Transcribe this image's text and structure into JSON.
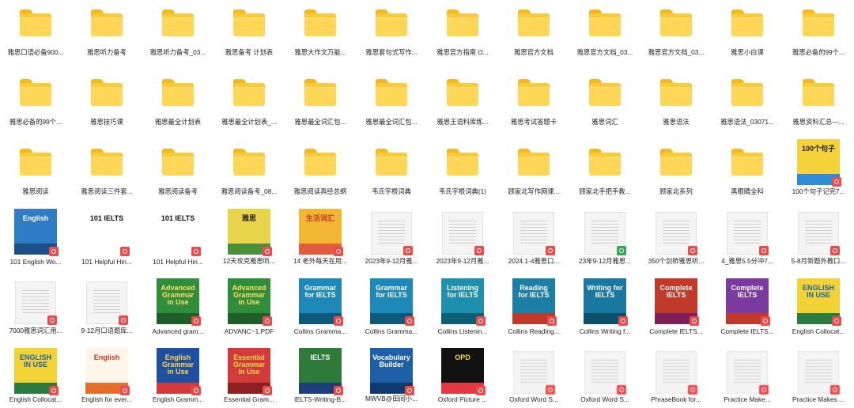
{
  "colors": {
    "folder": "#fcca36",
    "pdf_badge": "#ec4b4b",
    "xls_badge": "#32a852"
  },
  "items": [
    {
      "label": "雅思口语必备900...",
      "type": "folder"
    },
    {
      "label": "雅思听力备考",
      "type": "folder"
    },
    {
      "label": "雅思听力备考_03...",
      "type": "folder"
    },
    {
      "label": "雅思备考 计划表",
      "type": "folder"
    },
    {
      "label": "雅思大作文万能...",
      "type": "folder"
    },
    {
      "label": "雅思套句式写作...",
      "type": "folder"
    },
    {
      "label": "雅思官方指南 O...",
      "type": "folder"
    },
    {
      "label": "雅思官方文档",
      "type": "folder"
    },
    {
      "label": "雅思官方文档_03...",
      "type": "folder"
    },
    {
      "label": "雅思官方文档_03...",
      "type": "folder"
    },
    {
      "label": "雅思小白课",
      "type": "folder"
    },
    {
      "label": "雅思必备的99个...",
      "type": "folder"
    },
    {
      "label": "雅思必备的99个...",
      "type": "folder"
    },
    {
      "label": "雅思技巧课",
      "type": "folder"
    },
    {
      "label": "雅思最全计划表",
      "type": "folder"
    },
    {
      "label": "雅思最全计划表_...",
      "type": "folder"
    },
    {
      "label": "雅思最全词汇包...",
      "type": "folder"
    },
    {
      "label": "雅思最全词汇包...",
      "type": "folder"
    },
    {
      "label": "雅思王语料库练...",
      "type": "folder"
    },
    {
      "label": "雅思考试答题卡",
      "type": "folder"
    },
    {
      "label": "雅思词汇",
      "type": "folder"
    },
    {
      "label": "雅思语法",
      "type": "folder"
    },
    {
      "label": "雅思语法_03071...",
      "type": "folder"
    },
    {
      "label": "雅思资料汇总—...",
      "type": "folder"
    },
    {
      "label": "雅思阅读",
      "type": "folder"
    },
    {
      "label": "雅思阅读三件套...",
      "type": "folder"
    },
    {
      "label": "雅思阅读备考",
      "type": "folder"
    },
    {
      "label": "雅思阅读备考_08...",
      "type": "folder"
    },
    {
      "label": "雅思阅读真经总纲",
      "type": "folder"
    },
    {
      "label": "韦氏字根词典",
      "type": "folder"
    },
    {
      "label": "韦氏字根词典(1)",
      "type": "folder"
    },
    {
      "label": "顾家北写作网课...",
      "type": "folder"
    },
    {
      "label": "顾家北手把手教...",
      "type": "folder"
    },
    {
      "label": "顾家北系列",
      "type": "folder"
    },
    {
      "label": "黑眼睛全科",
      "type": "folder"
    },
    {
      "label": "100个句子记完7...",
      "type": "pdf",
      "cover": {
        "bg": "#f6d23a",
        "band": "#2e8bd6",
        "title": "100个句子",
        "fg": "#1b1b1b"
      }
    },
    {
      "label": "101 English Wo...",
      "type": "pdf",
      "cover": {
        "bg": "#2f7bc6",
        "band": "#1c4f86",
        "title": "English",
        "fg": "#ffffff"
      }
    },
    {
      "label": "101 Helpful Hin...",
      "type": "pdf",
      "cover": {
        "bg": "#ffffff",
        "band": "#ffffff",
        "title": "101 IELTS",
        "fg": "#111111"
      }
    },
    {
      "label": "101 Helpful Hin...",
      "type": "pdf",
      "cover": {
        "bg": "#ffffff",
        "band": "#ffffff",
        "title": "101 IELTS",
        "fg": "#111111"
      }
    },
    {
      "label": "12天攻克雅思听...",
      "type": "pdf",
      "cover": {
        "bg": "#e8d44a",
        "band": "#4a8f3c",
        "title": "雅思",
        "fg": "#222222"
      }
    },
    {
      "label": "14 老外每天在用...",
      "type": "pdf",
      "cover": {
        "bg": "#f2b632",
        "band": "#e25b3a",
        "title": "生活词汇",
        "fg": "#c0392b"
      }
    },
    {
      "label": "2023年9-12月雅...",
      "type": "pdf"
    },
    {
      "label": "2023年9-12月雅...",
      "type": "pdf"
    },
    {
      "label": "2024.1-4雅思口...",
      "type": "pdf"
    },
    {
      "label": "23年9-12月雅思...",
      "type": "xls"
    },
    {
      "label": "350个剑桥雅思听...",
      "type": "pdf"
    },
    {
      "label": "4_雅思5.5分冲7...",
      "type": "pdf"
    },
    {
      "label": "5-8月新题外教口...",
      "type": "pdf"
    },
    {
      "label": "7000雅思词汇用...",
      "type": "pdf"
    },
    {
      "label": "9-12月口语题库...",
      "type": "pdf"
    },
    {
      "label": "Advanced gram...",
      "type": "pdf",
      "cover": {
        "bg": "#2f8d3c",
        "band": "#1e5e28",
        "title": "Advanced Grammar in Use",
        "fg": "#ffe066"
      }
    },
    {
      "label": "ADVANC~1.PDF",
      "type": "pdf",
      "cover": {
        "bg": "#2f8d3c",
        "band": "#1e5e28",
        "title": "Advanced Grammar in Use",
        "fg": "#ffe066"
      }
    },
    {
      "label": "Collins Gramma...",
      "type": "pdf",
      "cover": {
        "bg": "#1e88b8",
        "band": "#0f5a7c",
        "title": "Grammar for IELTS",
        "fg": "#ffffff"
      }
    },
    {
      "label": "Collins Gramma...",
      "type": "pdf",
      "cover": {
        "bg": "#1e88b8",
        "band": "#0f5a7c",
        "title": "Grammar for IELTS",
        "fg": "#ffffff"
      }
    },
    {
      "label": "Collins Listenin...",
      "type": "pdf",
      "cover": {
        "bg": "#1f8fae",
        "band": "#0d5f76",
        "title": "Listening for IELTS",
        "fg": "#ffffff"
      }
    },
    {
      "label": "Collins Reading...",
      "type": "pdf",
      "cover": {
        "bg": "#1d7fa6",
        "band": "#c0392b",
        "title": "Reading for IELTS",
        "fg": "#ffffff"
      }
    },
    {
      "label": "Collins Writing f...",
      "type": "pdf",
      "cover": {
        "bg": "#1a78a0",
        "band": "#0c4f6b",
        "title": "Writing for IELTS",
        "fg": "#ffffff"
      }
    },
    {
      "label": "Complete IELTS...",
      "type": "pdf",
      "cover": {
        "bg": "#c0392b",
        "band": "#7d1f5a",
        "title": "Complete IELTS",
        "fg": "#ffffff"
      }
    },
    {
      "label": "Complete IELTS...",
      "type": "pdf",
      "cover": {
        "bg": "#7b3aa0",
        "band": "#c0392b",
        "title": "Complete IELTS",
        "fg": "#ffffff"
      }
    },
    {
      "label": "English Collocat...",
      "type": "pdf",
      "cover": {
        "bg": "#f2d335",
        "band": "#2b7a3f",
        "title": "ENGLISH IN USE",
        "fg": "#1f5fa8"
      }
    },
    {
      "label": "English Collocat...",
      "type": "pdf",
      "cover": {
        "bg": "#f2d335",
        "band": "#2b7a3f",
        "title": "ENGLISH IN USE",
        "fg": "#1f5fa8"
      }
    },
    {
      "label": "English for ever...",
      "type": "pdf",
      "cover": {
        "bg": "#fff6ea",
        "band": "#e36d2c",
        "title": "English",
        "fg": "#c0392b"
      }
    },
    {
      "label": "English Gramm...",
      "type": "pdf",
      "cover": {
        "bg": "#1f4fa0",
        "band": "#d13b3b",
        "title": "English Grammar in Use",
        "fg": "#ffd84a"
      }
    },
    {
      "label": "Essential Gram...",
      "type": "pdf",
      "cover": {
        "bg": "#d13b3b",
        "band": "#8e1f1f",
        "title": "Essential Grammar in Use",
        "fg": "#ffd84a"
      }
    },
    {
      "label": "IELTS-Writing-B...",
      "type": "pdf",
      "cover": {
        "bg": "#2d7a3b",
        "band": "#1c3f7a",
        "title": "IELTS",
        "fg": "#ffffff"
      }
    },
    {
      "label": "MWVB@田间小...",
      "type": "pdf",
      "cover": {
        "bg": "#1f5fa8",
        "band": "#0e3a6e",
        "title": "Vocabulary Builder",
        "fg": "#ffffff"
      }
    },
    {
      "label": "Oxford Picture ...",
      "type": "pdf",
      "cover": {
        "bg": "#111111",
        "band": "#e63946",
        "title": "OPD",
        "fg": "#ffd84a"
      }
    },
    {
      "label": "Oxford Word S...",
      "type": "pdf",
      "blur": true
    },
    {
      "label": "Oxford Word S...",
      "type": "pdf",
      "blur": true
    },
    {
      "label": "PhraseBook for...",
      "type": "pdf",
      "blur": true
    },
    {
      "label": "Practice Make...",
      "type": "pdf",
      "blur": true
    },
    {
      "label": "Practice Makes ...",
      "type": "pdf",
      "blur": true
    }
  ]
}
